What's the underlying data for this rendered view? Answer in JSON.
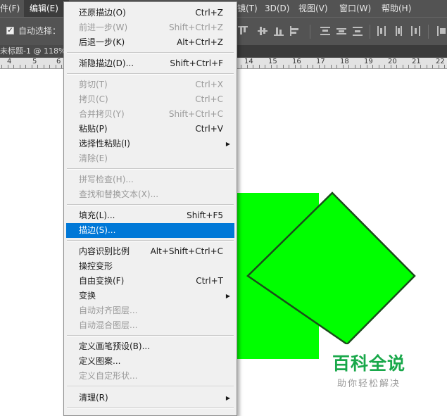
{
  "menubar": {
    "file_fragment": "件(F)",
    "edit": "编辑(E)",
    "filter_fragment": "镜(T)",
    "threed": "3D(D)",
    "view": "视图(V)",
    "window": "窗口(W)",
    "help": "帮助(H)"
  },
  "options": {
    "auto_select_label": "自动选择：",
    "auto_select_checked": true
  },
  "document": {
    "tab_label": "未标题-1 @ 118%"
  },
  "ruler": {
    "labels_left": [
      "4",
      "5",
      "6"
    ],
    "labels_right": [
      "14",
      "15",
      "16",
      "17",
      "18",
      "19",
      "20",
      "21",
      "22"
    ]
  },
  "edit_menu": {
    "items": [
      {
        "label": "还原描边(O)",
        "shortcut": "Ctrl+Z",
        "state": "enabled"
      },
      {
        "label": "前进一步(W)",
        "shortcut": "Shift+Ctrl+Z",
        "state": "disabled"
      },
      {
        "label": "后退一步(K)",
        "shortcut": "Alt+Ctrl+Z",
        "state": "enabled"
      },
      {
        "label": "渐隐描边(D)...",
        "shortcut": "Shift+Ctrl+F",
        "state": "enabled"
      },
      {
        "label": "剪切(T)",
        "shortcut": "Ctrl+X",
        "state": "disabled"
      },
      {
        "label": "拷贝(C)",
        "shortcut": "Ctrl+C",
        "state": "disabled"
      },
      {
        "label": "合并拷贝(Y)",
        "shortcut": "Shift+Ctrl+C",
        "state": "disabled"
      },
      {
        "label": "粘贴(P)",
        "shortcut": "Ctrl+V",
        "state": "enabled"
      },
      {
        "label": "选择性粘贴(I)",
        "shortcut": "",
        "state": "enabled",
        "submenu": true
      },
      {
        "label": "清除(E)",
        "shortcut": "",
        "state": "disabled"
      },
      {
        "label": "拼写检查(H)...",
        "shortcut": "",
        "state": "disabled"
      },
      {
        "label": "查找和替换文本(X)...",
        "shortcut": "",
        "state": "disabled"
      },
      {
        "label": "填充(L)...",
        "shortcut": "Shift+F5",
        "state": "enabled"
      },
      {
        "label": "描边(S)...",
        "shortcut": "",
        "state": "highlighted"
      },
      {
        "label": "内容识别比例",
        "shortcut": "Alt+Shift+Ctrl+C",
        "state": "enabled"
      },
      {
        "label": "操控变形",
        "shortcut": "",
        "state": "enabled"
      },
      {
        "label": "自由变换(F)",
        "shortcut": "Ctrl+T",
        "state": "enabled"
      },
      {
        "label": "变换",
        "shortcut": "",
        "state": "enabled",
        "submenu": true
      },
      {
        "label": "自动对齐图层...",
        "shortcut": "",
        "state": "disabled"
      },
      {
        "label": "自动混合图层...",
        "shortcut": "",
        "state": "disabled"
      },
      {
        "label": "定义画笔预设(B)...",
        "shortcut": "",
        "state": "enabled"
      },
      {
        "label": "定义图案...",
        "shortcut": "",
        "state": "enabled"
      },
      {
        "label": "定义自定形状...",
        "shortcut": "",
        "state": "disabled"
      },
      {
        "label": "清理(R)",
        "shortcut": "",
        "state": "enabled",
        "submenu": true
      }
    ]
  },
  "watermark": {
    "title": "百科全说",
    "subtitle": "助你轻松解决"
  },
  "colors": {
    "shape_fill": "#00ff00",
    "shape_stroke": "#1a4d1a",
    "menu_highlight": "#0078d7",
    "watermark_green": "#19a84a"
  },
  "icons": {
    "submenu": "triangle-right",
    "checkbox": "check"
  }
}
